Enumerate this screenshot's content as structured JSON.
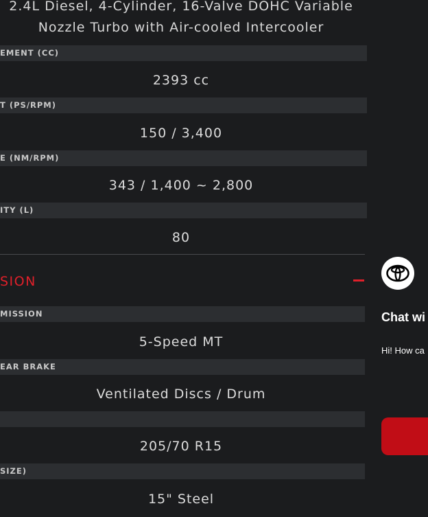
{
  "specs": {
    "engine_description_line1": "2.4L Diesel, 4-Cylinder, 16-Valve DOHC Variable",
    "engine_description_line2": "Nozzle Turbo with Air-cooled Intercooler",
    "rows": [
      {
        "label": "EMENT (CC)",
        "value": "2393 cc"
      },
      {
        "label": "T (PS/RPM)",
        "value": "150 / 3,400"
      },
      {
        "label": "E (NM/RPM)",
        "value": "343 / 1,400 ~ 2,800"
      },
      {
        "label": "ITY (L)",
        "value": "80"
      }
    ]
  },
  "transmission_section": {
    "title": "SION",
    "toggle_symbol": "minus",
    "rows": [
      {
        "label": "MISSION",
        "value": "5-Speed MT"
      },
      {
        "label": "EAR BRAKE",
        "value": "Ventilated Discs / Drum"
      },
      {
        "label": "",
        "value": "205/70 R15"
      },
      {
        "label": "SIZE)",
        "value": "15\" Steel"
      }
    ]
  },
  "chat_widget": {
    "avatar_icon": "toyota-logo-icon",
    "title": "Chat wi",
    "greeting": "Hi! How ca",
    "button_color": "#c10d16"
  },
  "colors": {
    "background": "#1b1c1e",
    "label_bar": "#2c2e31",
    "accent_red": "#e0202a",
    "text": "#dcdcdc"
  }
}
